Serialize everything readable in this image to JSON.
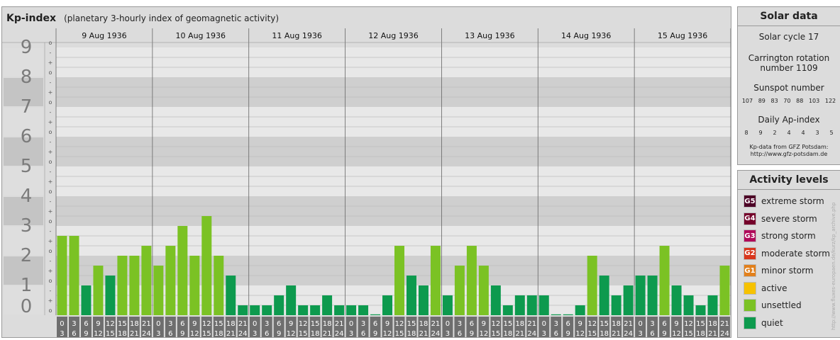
{
  "header": {
    "title": "Kp-index",
    "subtitle": "(planetary 3-hourly index of geomagnetic activity)"
  },
  "chart_data": {
    "type": "bar",
    "title": "Kp-index",
    "subtitle": "(planetary 3-hourly index of geomagnetic activity)",
    "ylim": [
      0,
      9
    ],
    "y_ticks": [
      "0",
      "1",
      "2",
      "3",
      "4",
      "5",
      "6",
      "7",
      "8",
      "9"
    ],
    "y_minor_ticks": [
      "o",
      "+",
      "-"
    ],
    "days": [
      "9 Aug 1936",
      "10 Aug 1936",
      "11 Aug 1936",
      "12 Aug 1936",
      "13 Aug 1936",
      "14 Aug 1936",
      "15 Aug 1936"
    ],
    "hour_labels_top": [
      "0",
      "3",
      "6",
      "9",
      "12",
      "15",
      "18",
      "21"
    ],
    "hour_labels_bottom": [
      "3",
      "6",
      "9",
      "12",
      "15",
      "18",
      "21",
      "24"
    ],
    "series": [
      {
        "values": [
          2.667,
          2.667,
          1.0,
          1.667,
          1.333,
          2.0,
          2.0,
          2.333
        ]
      },
      {
        "values": [
          1.667,
          2.333,
          3.0,
          2.0,
          3.333,
          2.0,
          1.333,
          0.333
        ]
      },
      {
        "values": [
          0.333,
          0.333,
          0.667,
          1.0,
          0.333,
          0.333,
          0.667,
          0.333
        ]
      },
      {
        "values": [
          0.333,
          0.333,
          0.0,
          0.667,
          2.333,
          1.333,
          1.0,
          2.333
        ]
      },
      {
        "values": [
          0.667,
          1.667,
          2.333,
          1.667,
          1.0,
          0.333,
          0.667,
          0.667
        ]
      },
      {
        "values": [
          0.667,
          0.0,
          0.0,
          0.333,
          2.0,
          1.333,
          0.667,
          1.0
        ]
      },
      {
        "values": [
          1.333,
          1.333,
          2.333,
          1.0,
          0.667,
          0.333,
          0.667,
          1.667
        ]
      }
    ],
    "colors": {
      "quiet": "#0d9a4e",
      "unsettled": "#7bc224"
    }
  },
  "solar": {
    "title": "Solar data",
    "cycle": "Solar cycle 17",
    "carrington_line1": "Carrington rotation",
    "carrington_line2": "number 1109",
    "sunspot_label": "Sunspot number",
    "sunspots": [
      "107",
      "89",
      "83",
      "70",
      "88",
      "103",
      "122"
    ],
    "ap_label": "Daily Ap-index",
    "ap_values": [
      "8",
      "9",
      "2",
      "4",
      "4",
      "3",
      "5"
    ],
    "source_line1": "Kp-data from GFZ Potsdam:",
    "source_line2": "http://www.gfz-potsdam.de"
  },
  "activity": {
    "title": "Activity levels",
    "items": [
      {
        "code": "G5",
        "label": "extreme storm",
        "color": "#4d0026"
      },
      {
        "code": "G4",
        "label": "severe storm",
        "color": "#75002a"
      },
      {
        "code": "G3",
        "label": "strong storm",
        "color": "#b00a5a"
      },
      {
        "code": "G2",
        "label": "moderate storm",
        "color": "#d8361c"
      },
      {
        "code": "G1",
        "label": "minor storm",
        "color": "#e2801c"
      },
      {
        "code": "",
        "label": "active",
        "color": "#f6c200"
      },
      {
        "code": "",
        "label": "unsettled",
        "color": "#7bc224"
      },
      {
        "code": "",
        "label": "quiet",
        "color": "#0d9a4e"
      }
    ]
  },
  "credit": "http://www.fluxes-europaen.de/kurz/kp_archive.php"
}
